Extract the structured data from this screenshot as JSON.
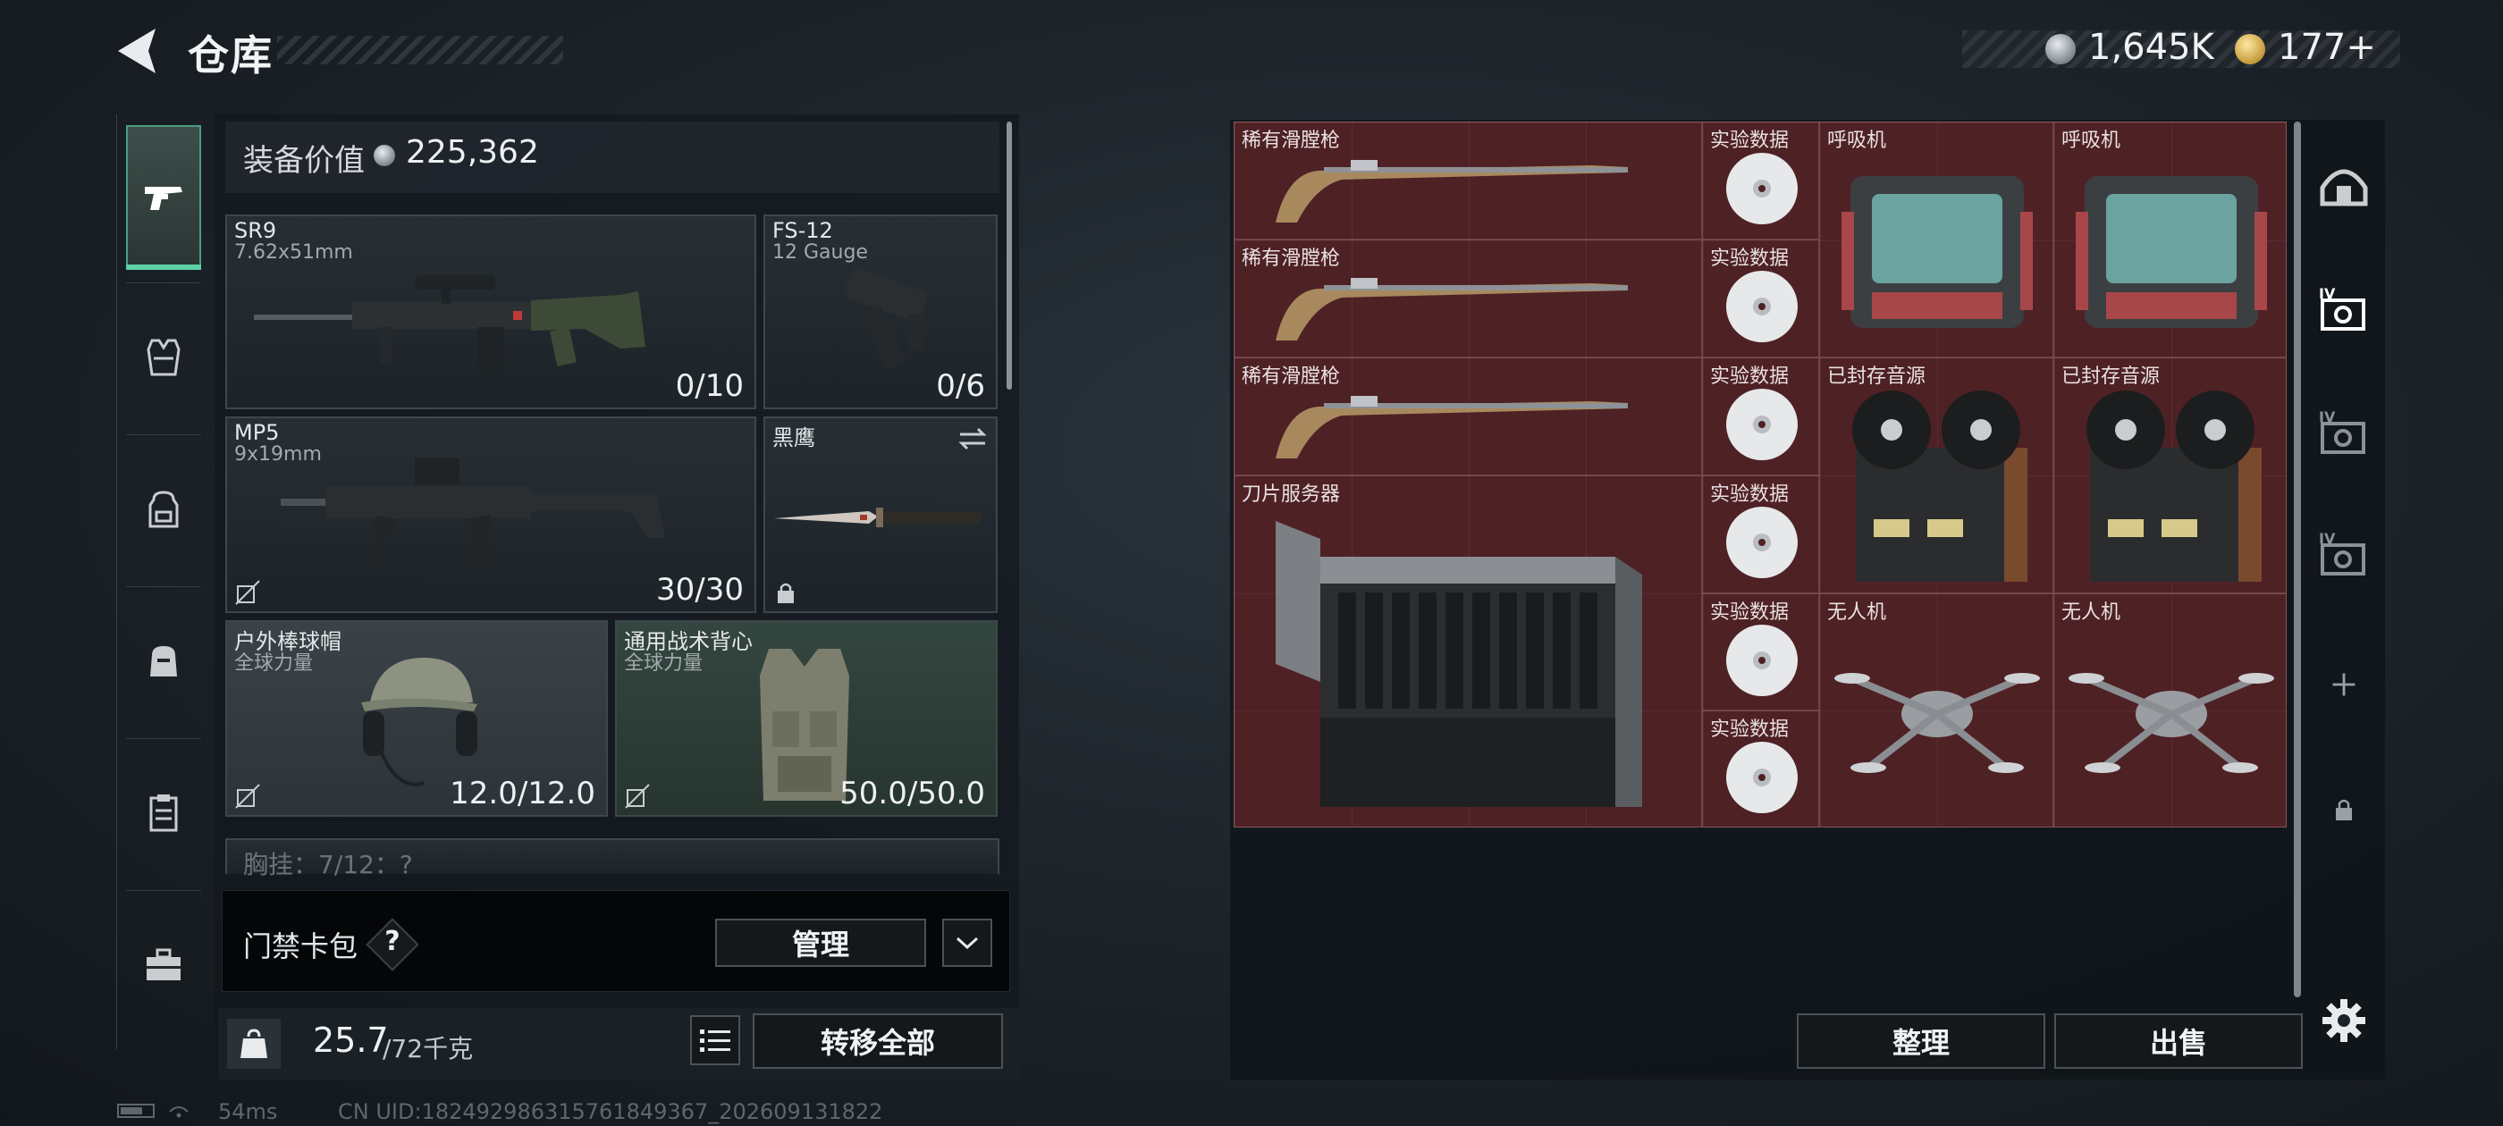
{
  "header": {
    "title": "仓库",
    "currency_silver": "1,645K",
    "currency_gold": "177+"
  },
  "loadout": {
    "equipment_value_label": "装备价值",
    "equipment_value": "225,362",
    "slots": [
      {
        "name": "SR9",
        "sub": "7.62x51mm",
        "count": "0/10"
      },
      {
        "name": "FS-12",
        "sub": "12 Gauge",
        "count": "0/6"
      },
      {
        "name": "MP5",
        "sub": "9x19mm",
        "count": "30/30"
      },
      {
        "name": "黑鹰",
        "sub": "",
        "count": ""
      },
      {
        "name": "户外棒球帽",
        "sub": "全球力量",
        "count": "12.0/12.0"
      },
      {
        "name": "通用战术背心",
        "sub": "全球力量",
        "count": "50.0/50.0"
      }
    ],
    "chest_label": "胸挂：7/12：?",
    "keycard_label": "门禁卡包",
    "keycard_help": "?",
    "manage_label": "管理",
    "weight_current": "25.7",
    "weight_max": "/72千克",
    "transfer_all_label": "转移全部"
  },
  "status": {
    "ping": "54ms",
    "uid": "CN UID:1824929863157618493​67_202609131822"
  },
  "storage": {
    "items": [
      {
        "label": "稀有滑膛枪"
      },
      {
        "label": "稀有滑膛枪"
      },
      {
        "label": "稀有滑膛枪"
      },
      {
        "label": "实验数据"
      },
      {
        "label": "实验数据"
      },
      {
        "label": "实验数据"
      },
      {
        "label": "实验数据"
      },
      {
        "label": "实验数据"
      },
      {
        "label": "实验数据"
      },
      {
        "label": "呼吸机"
      },
      {
        "label": "呼吸机"
      },
      {
        "label": "已封存音源"
      },
      {
        "label": "已封存音源"
      },
      {
        "label": "刀片服务器"
      },
      {
        "label": "无人机"
      },
      {
        "label": "无人机"
      }
    ],
    "sort_label": "整理",
    "sell_label": "出售"
  },
  "colors": {
    "accent": "#5fd0a6",
    "storage_bg": "#4e2125",
    "vest_slot_bg": "#33463f"
  },
  "icons": {
    "back": "back-arrow-icon",
    "rail": [
      "pistol-icon",
      "armor-icon",
      "backpack-icon",
      "bag-icon",
      "clipboard-icon",
      "toolbox-icon"
    ],
    "tabs": [
      "home-vault-icon",
      "vault-iv-icon",
      "vault-iv-icon",
      "vault-iv-icon",
      "plus-icon",
      "lock-icon"
    ],
    "settings": "gear-icon"
  }
}
